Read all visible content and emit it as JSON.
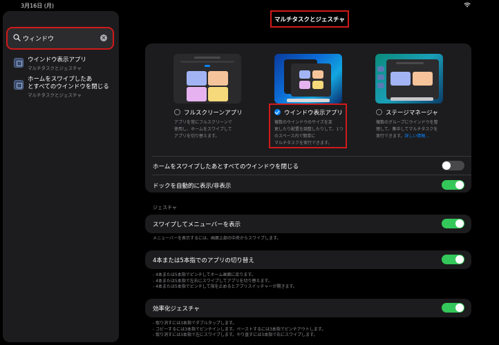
{
  "status": {
    "time": "3月16日 (月)"
  },
  "sidebar": {
    "search": {
      "value": "ウィンドウ"
    },
    "results": [
      {
        "title": "ウインドウ表示アプリ",
        "subtitle": "マルチタスクとジェスチャ"
      },
      {
        "title_line1": "ホームをスワイプしたあ",
        "title_line2": "とすべてのウインドウを閉じる",
        "subtitle": "マルチタスクとジェスチャ"
      }
    ]
  },
  "main": {
    "title": "マルチタスクとジェスチャ",
    "options": [
      {
        "label": "フルスクリーンアプリ",
        "selected": false,
        "desc": [
          "アプリを常にフルスクリーンで",
          "使用し、ホームをスワイプして",
          "アプリを切り替えます。"
        ]
      },
      {
        "label": "ウインドウ表示アプリ",
        "selected": true,
        "desc": [
          "複数のウインドウのサイズを変",
          "更したり配置を調整したりして、1つのスペース内で簡単に",
          "マルチタスクを実行できます。"
        ]
      },
      {
        "label": "ステージマネージャ",
        "selected": false,
        "desc": [
          "複数のグループにウインドウを整",
          "理して、集中してマルチタスクを",
          "実行できます。"
        ],
        "link": "詳しい情報..."
      }
    ],
    "settings": [
      {
        "label": "ホームをスワイプしたあとすべてのウインドウを閉じる",
        "on": false
      },
      {
        "label": "ドックを自動的に表示/非表示",
        "on": true
      }
    ],
    "gestures_header": "ジェスチャ",
    "gestures": [
      {
        "label": "スワイプしてメニューバーを表示",
        "on": true,
        "footnote": [
          "メニューバーを表示するには、画面上部の中央からスワイプします。"
        ]
      },
      {
        "label": "4本または5本指でのアプリの切り替え",
        "on": true,
        "footnote": [
          "- 4本または5本指でピンチしてホーム画面に戻ります。",
          "- 4本または5本指で左右にスワイプしてアプリを切り替えます。",
          "- 4本または5本指でピンチして指を止めるとアプリスイッチャーが開きます。"
        ]
      },
      {
        "label": "効率化ジェスチャ",
        "on": true,
        "footnote": [
          "- 取り消すには3本指でダブルタップします。",
          "- コピーするには3本指でピンチインします。ペーストするには3本指でピンチアウトします。",
          "- 取り消すには3本指で左にスワイプします。やり直すには3本指で右にスワイプします。"
        ]
      }
    ]
  }
}
